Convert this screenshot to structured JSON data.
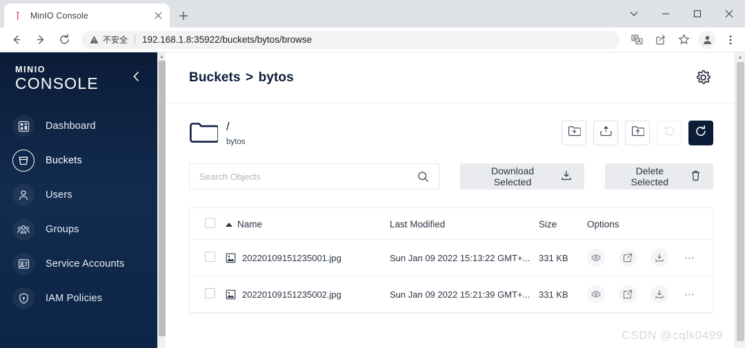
{
  "browser": {
    "tab": {
      "title": "MinIO Console",
      "favicon": "minio-flamingo-icon",
      "close_label": "✕"
    },
    "new_tab_label": "+",
    "window_controls": {
      "minimize": "–",
      "maximize": "□",
      "close": "✕",
      "dropdown": "⌄"
    },
    "nav": {
      "back": "←",
      "forward": "→",
      "reload": "↻"
    },
    "omnibox": {
      "security_label": "不安全",
      "security_icon": "warning-triangle-icon",
      "url": "192.168.1.8:35922/buckets/bytos/browse"
    },
    "toolbar_icons": [
      "translate-icon",
      "share-icon",
      "bookmark-star-icon",
      "profile-avatar-icon",
      "three-dot-menu-icon"
    ]
  },
  "sidebar": {
    "logo_top": "MINIO",
    "logo_bottom": "CONSOLE",
    "collapse_icon": "chevron-left-icon",
    "items": [
      {
        "label": "Dashboard",
        "icon": "dashboard-icon",
        "active": false
      },
      {
        "label": "Buckets",
        "icon": "bucket-icon",
        "active": true
      },
      {
        "label": "Users",
        "icon": "user-icon",
        "active": false
      },
      {
        "label": "Groups",
        "icon": "groups-icon",
        "active": false
      },
      {
        "label": "Service Accounts",
        "icon": "service-account-icon",
        "active": false
      },
      {
        "label": "IAM Policies",
        "icon": "shield-icon",
        "active": false
      }
    ]
  },
  "header": {
    "breadcrumb_root": "Buckets",
    "breadcrumb_sep": ">",
    "breadcrumb_current": "bytos",
    "settings_icon": "gear-icon"
  },
  "path_bar": {
    "folder_icon": "folder-icon",
    "path": "/",
    "bucket_name": "bytos"
  },
  "actions": [
    {
      "name": "create-new-path-button",
      "icon": "folder-plus-icon",
      "state": "enabled"
    },
    {
      "name": "upload-file-button",
      "icon": "upload-icon",
      "state": "enabled"
    },
    {
      "name": "upload-folder-button",
      "icon": "folder-upload-icon",
      "state": "enabled"
    },
    {
      "name": "rewind-button",
      "icon": "rewind-icon",
      "state": "disabled"
    },
    {
      "name": "refresh-button",
      "icon": "refresh-icon",
      "state": "primary"
    }
  ],
  "search": {
    "placeholder": "Search Objects",
    "value": "",
    "icon": "search-icon"
  },
  "buttons": {
    "download_selected": "Download Selected",
    "download_icon": "download-icon",
    "delete_selected": "Delete Selected",
    "delete_icon": "trash-icon"
  },
  "table": {
    "columns": [
      "Name",
      "Last Modified",
      "Size",
      "Options"
    ],
    "sort_column": "Name",
    "sort_direction": "ascending",
    "rows": [
      {
        "selected": false,
        "icon": "image-file-icon",
        "name": "20220109151235001.jpg",
        "last_modified": "Sun Jan 09 2022 15:13:22 GMT+...",
        "size": "331 KB",
        "options": [
          "preview-icon",
          "share-icon",
          "download-icon",
          "more-icon"
        ]
      },
      {
        "selected": false,
        "icon": "image-file-icon",
        "name": "20220109151235002.jpg",
        "last_modified": "Sun Jan 09 2022 15:21:39 GMT+...",
        "size": "331 KB",
        "options": [
          "preview-icon",
          "share-icon",
          "download-icon",
          "more-icon"
        ]
      }
    ],
    "more_glyph": "⋯"
  },
  "watermark": "CSDN @cqlk0499",
  "colors": {
    "sidebar_dark": "#0b1c38",
    "primary": "#0b1c38",
    "chrome_tabstrip": "#dee1e6"
  }
}
